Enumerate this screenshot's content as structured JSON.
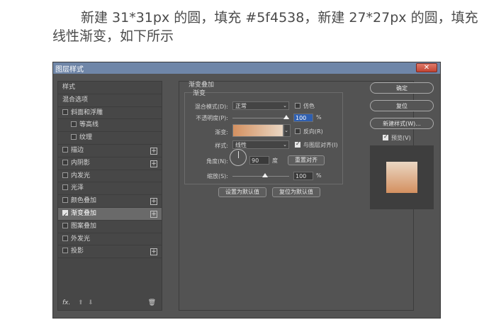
{
  "caption": {
    "line1": "新建 31*31px 的圆，填充 #5f4538，新建 27*27px 的圆，填充",
    "line2": "线性渐变，如下所示"
  },
  "dialog": {
    "title": "图层样式",
    "close_label": "✕",
    "left_panel": {
      "items": [
        {
          "label": "样式",
          "checkbox": false,
          "plus": false,
          "checked": false
        },
        {
          "label": "混合选项",
          "checkbox": false,
          "plus": false,
          "checked": false
        },
        {
          "label": "斜面和浮雕",
          "checkbox": true,
          "plus": false,
          "checked": false
        },
        {
          "label": "等高线",
          "checkbox": true,
          "plus": false,
          "checked": false,
          "indent": true
        },
        {
          "label": "纹理",
          "checkbox": true,
          "plus": false,
          "checked": false,
          "indent": true
        },
        {
          "label": "描边",
          "checkbox": true,
          "plus": true,
          "checked": false
        },
        {
          "label": "内阴影",
          "checkbox": true,
          "plus": true,
          "checked": false
        },
        {
          "label": "内发光",
          "checkbox": true,
          "plus": false,
          "checked": false
        },
        {
          "label": "光泽",
          "checkbox": true,
          "plus": false,
          "checked": false
        },
        {
          "label": "颜色叠加",
          "checkbox": true,
          "plus": true,
          "checked": false
        },
        {
          "label": "渐变叠加",
          "checkbox": true,
          "plus": true,
          "checked": true,
          "selected": true
        },
        {
          "label": "图案叠加",
          "checkbox": true,
          "plus": false,
          "checked": false
        },
        {
          "label": "外发光",
          "checkbox": true,
          "plus": false,
          "checked": false
        },
        {
          "label": "投影",
          "checkbox": true,
          "plus": true,
          "checked": false
        }
      ],
      "footer": {
        "fx": "fx.",
        "up": "⬆",
        "down": "⬇",
        "trash": "🗑"
      }
    },
    "gradient_overlay": {
      "section_title": "渐变叠加",
      "group_title": "渐变",
      "blend_mode_label": "混合模式(D):",
      "blend_mode_value": "正常",
      "dither_label": "仿色",
      "opacity_label": "不透明度(P):",
      "opacity_value": "100",
      "opacity_unit": "%",
      "gradient_label": "渐变:",
      "reverse_label": "反向(R)",
      "style_label": "样式:",
      "style_value": "线性",
      "align_layer_label": "与图层对齐(I)",
      "angle_label": "角度(N):",
      "angle_value": "90",
      "angle_unit": "度",
      "reset_align_label": "重置对齐",
      "scale_label": "缩放(S):",
      "scale_value": "100",
      "scale_unit": "%",
      "set_default_label": "设置为默认值",
      "reset_default_label": "复位为默认值"
    },
    "right_panel": {
      "ok_label": "确定",
      "reset_label": "复位",
      "new_style_label": "新建样式(W)...",
      "preview_label": "预览(V)"
    },
    "colors": {
      "gradient_start": "#d49060",
      "gradient_end": "#ead7c3",
      "titlebar": "#6f86a8"
    }
  }
}
